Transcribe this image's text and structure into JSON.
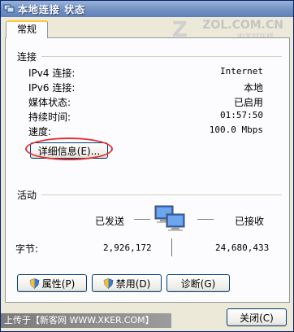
{
  "window": {
    "title": "本地连接 状态"
  },
  "watermark": {
    "brand": "ZOL.COM.CN",
    "sub": "中关村在线",
    "bottom": "上传于【新客网 WWW.XKER.COM】"
  },
  "tabs": [
    {
      "label": "常规"
    }
  ],
  "connection": {
    "title": "连接",
    "rows": [
      {
        "label": "IPv4 连接:",
        "value": "Internet"
      },
      {
        "label": "IPv6 连接:",
        "value": "本地"
      },
      {
        "label": "媒体状态:",
        "value": "已启用"
      },
      {
        "label": "持续时间:",
        "value": "01:57:50"
      },
      {
        "label": "速度:",
        "value": "100.0 Mbps"
      }
    ],
    "details_button": "详细信息(E)..."
  },
  "activity": {
    "title": "活动",
    "sent_label": "已发送",
    "received_label": "已接收",
    "bytes_label": "字节:",
    "bytes_sent": "2,926,172",
    "bytes_received": "24,680,433"
  },
  "buttons": {
    "properties": "属性(P)",
    "disable": "禁用(D)",
    "diagnose": "诊断(G)",
    "close": "关闭(C)"
  },
  "colors": {
    "highlight_ellipse": "#e03030",
    "titlebar": "#7796c6"
  }
}
